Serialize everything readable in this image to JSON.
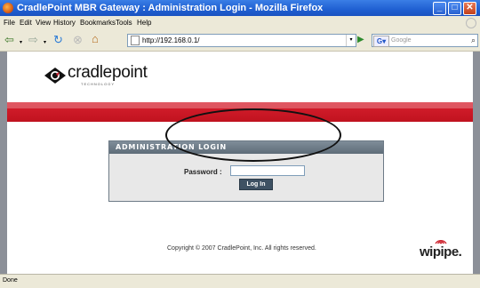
{
  "window": {
    "title": "CradlePoint MBR Gateway : Administration Login - Mozilla Firefox",
    "controls": [
      "minimize",
      "maximize",
      "close"
    ]
  },
  "menu": {
    "items": [
      "File",
      "Edit",
      "View",
      "History",
      "Bookmarks",
      "Tools",
      "Help"
    ]
  },
  "toolbar": {
    "url": "http://192.168.0.1/",
    "search_placeholder": "Google",
    "icons": [
      "back-icon",
      "forward-icon",
      "reload-icon",
      "stop-icon",
      "home-icon"
    ]
  },
  "page": {
    "brand": "cradlepoint",
    "brand_tagline": "TECHNOLOGY",
    "login": {
      "header": "ADMINISTRATION LOGIN",
      "password_label": "Password :",
      "password_value": "",
      "button_label": "Log In"
    },
    "copyright": "Copyright © 2007 CradlePoint, Inc. All rights reserved.",
    "partner_logo": "wipipe."
  },
  "status": {
    "text": "Done"
  },
  "colors": {
    "titlebar": "#2560d4",
    "brand_red": "#c8182a",
    "panel_header": "#6c7a86",
    "button": "#3e5163"
  }
}
